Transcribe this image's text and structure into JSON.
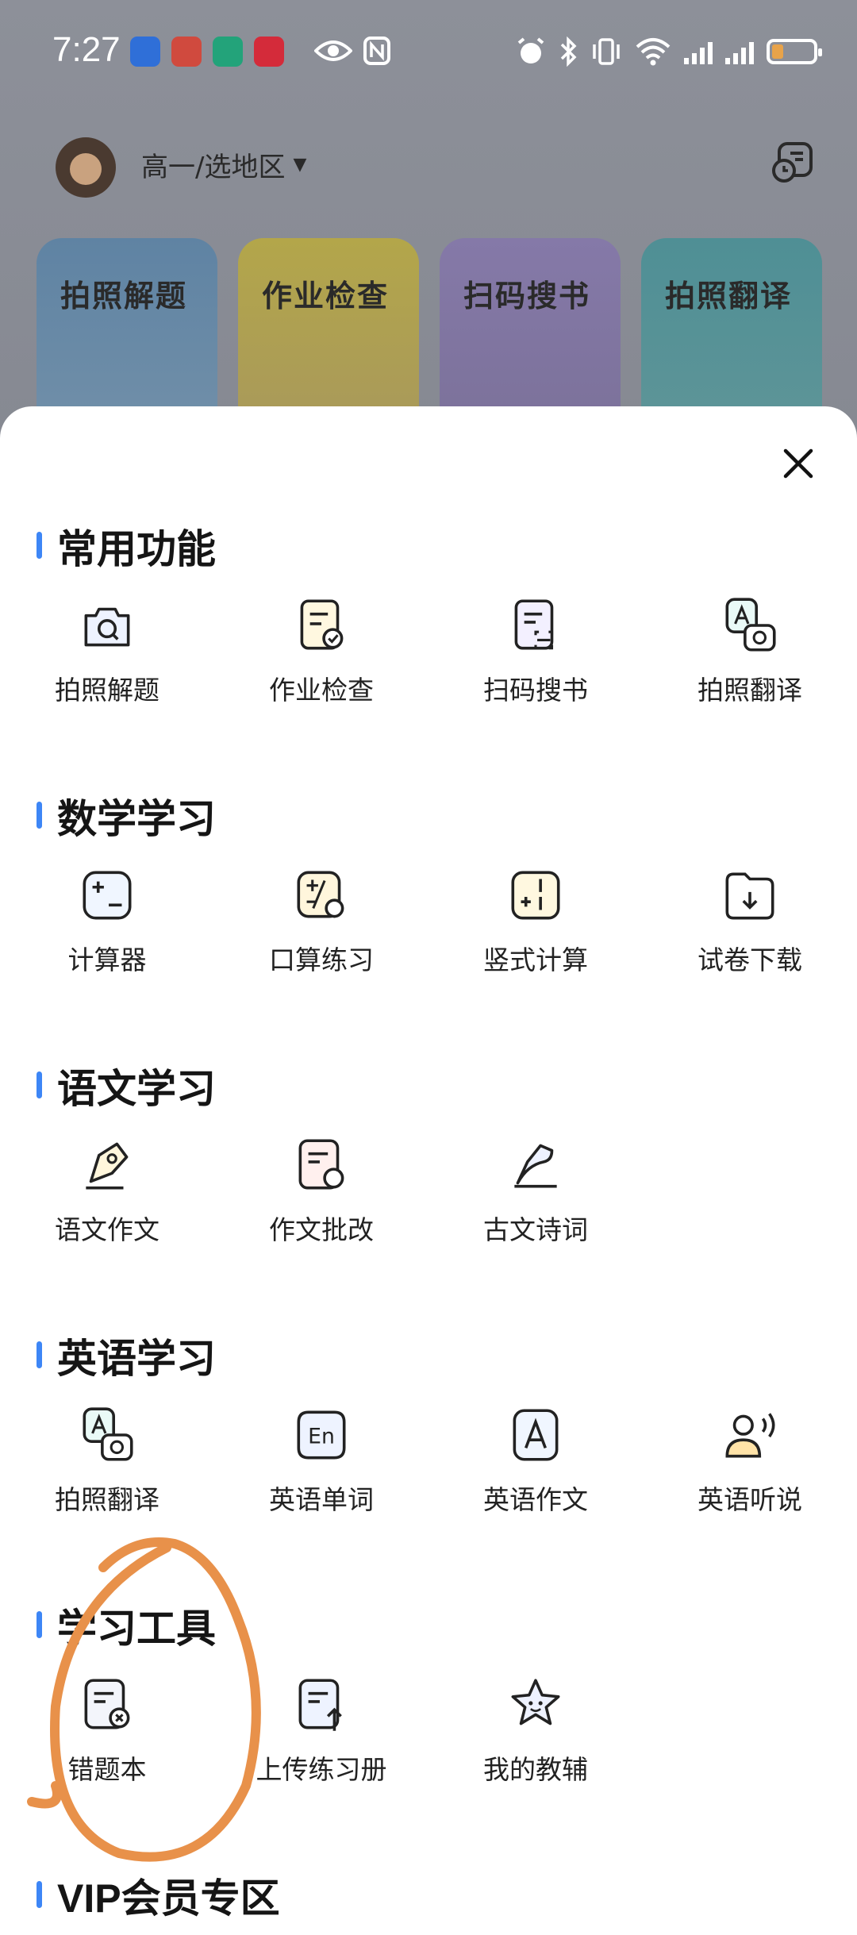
{
  "status_bar": {
    "time": "7:27"
  },
  "header": {
    "grade_region": "高一/选地区"
  },
  "tiles": [
    {
      "label": "拍照解题"
    },
    {
      "label": "作业检查"
    },
    {
      "label": "扫码搜书"
    },
    {
      "label": "拍照翻译"
    }
  ],
  "sections": [
    {
      "title": "常用功能",
      "items": [
        {
          "label": "拍照解题",
          "icon": "camera-search-icon"
        },
        {
          "label": "作业检查",
          "icon": "homework-check-icon"
        },
        {
          "label": "扫码搜书",
          "icon": "scan-book-icon"
        },
        {
          "label": "拍照翻译",
          "icon": "photo-translate-icon"
        }
      ]
    },
    {
      "title": "数学学习",
      "items": [
        {
          "label": "计算器",
          "icon": "calculator-icon"
        },
        {
          "label": "口算练习",
          "icon": "mental-math-icon"
        },
        {
          "label": "竖式计算",
          "icon": "vertical-calc-icon"
        },
        {
          "label": "试卷下载",
          "icon": "paper-download-icon"
        }
      ]
    },
    {
      "title": "语文学习",
      "items": [
        {
          "label": "语文作文",
          "icon": "pen-nib-icon"
        },
        {
          "label": "作文批改",
          "icon": "essay-correct-icon"
        },
        {
          "label": "古文诗词",
          "icon": "poetry-icon"
        }
      ]
    },
    {
      "title": "英语学习",
      "items": [
        {
          "label": "拍照翻译",
          "icon": "photo-translate-icon"
        },
        {
          "label": "英语单词",
          "icon": "english-words-icon"
        },
        {
          "label": "英语作文",
          "icon": "english-essay-icon"
        },
        {
          "label": "英语听说",
          "icon": "listening-speaking-icon"
        }
      ]
    },
    {
      "title": "学习工具",
      "items": [
        {
          "label": "错题本",
          "icon": "mistake-book-icon"
        },
        {
          "label": "上传练习册",
          "icon": "upload-workbook-icon"
        },
        {
          "label": "我的教辅",
          "icon": "my-materials-icon"
        }
      ]
    },
    {
      "title": "VIP会员专区",
      "items": []
    }
  ],
  "colors": {
    "accent": "#3d86f6",
    "annotation": "#e8914a",
    "sheet_bg": "#ffffff"
  }
}
